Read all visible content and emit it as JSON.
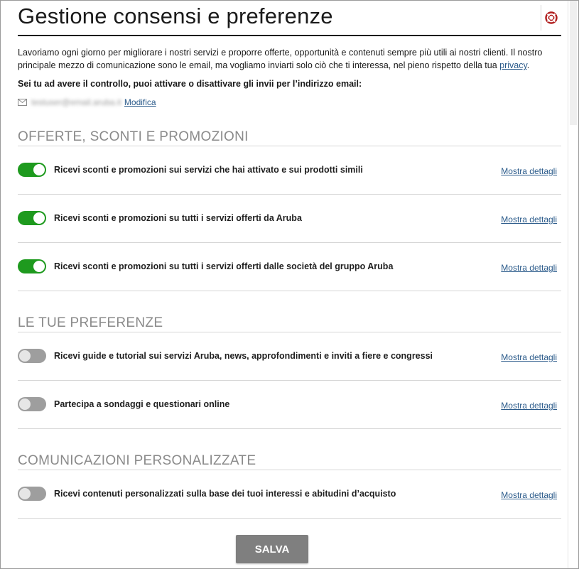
{
  "header": {
    "title": "Gestione consensi e preferenze",
    "help_icon": "lifebuoy-icon"
  },
  "intro": {
    "text": "Lavoriamo ogni giorno per migliorare i nostri servizi e proporre offerte, opportunità e contenuti sempre più utili ai nostri clienti. Il nostro principale mezzo di comunicazione sono le email, ma vogliamo inviarti solo ciò che ti interessa, nel pieno rispetto della tua ",
    "privacy_link": "privacy",
    "end": "."
  },
  "control_note": "Sei tu ad avere il controllo, puoi attivare o disattivare gli invii per l’indirizzo email:",
  "email": {
    "icon": "mail-icon",
    "address": "testuser@email.aruba.it",
    "modify_label": "Modifica"
  },
  "sections": [
    {
      "title": "OFFERTE, SCONTI E PROMOZIONI",
      "items": [
        {
          "label": "Ricevi sconti e promozioni sui servizi che hai attivato e sui prodotti simili",
          "enabled": true,
          "details_label": "Mostra dettagli"
        },
        {
          "label": "Ricevi sconti e promozioni su tutti i servizi offerti da Aruba",
          "enabled": true,
          "details_label": "Mostra dettagli"
        },
        {
          "label": "Ricevi sconti e promozioni su tutti i servizi offerti dalle società del gruppo Aruba",
          "enabled": true,
          "details_label": "Mostra dettagli"
        }
      ]
    },
    {
      "title": "LE TUE PREFERENZE",
      "items": [
        {
          "label": "Ricevi guide e tutorial sui servizi Aruba, news, approfondimenti e inviti a fiere e congressi",
          "enabled": false,
          "details_label": "Mostra dettagli"
        },
        {
          "label": "Partecipa a sondaggi e questionari online",
          "enabled": false,
          "details_label": "Mostra dettagli"
        }
      ]
    },
    {
      "title": "COMUNICAZIONI PERSONALIZZATE",
      "items": [
        {
          "label": "Ricevi contenuti personalizzati sulla base dei tuoi interessi e abitudini d’acquisto",
          "enabled": false,
          "details_label": "Mostra dettagli"
        }
      ]
    }
  ],
  "save_label": "SALVA",
  "colors": {
    "toggle_on": "#1e9a1e",
    "toggle_off": "#9e9e9e",
    "link": "#2a5a8a",
    "save_button": "#7f7f7f"
  }
}
